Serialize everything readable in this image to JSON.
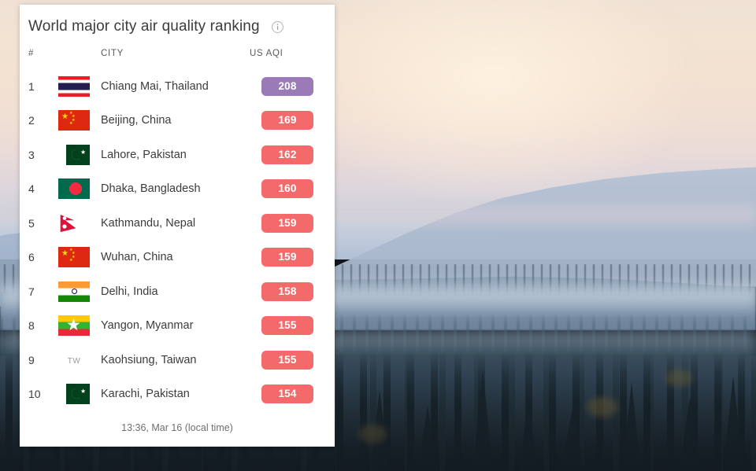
{
  "card": {
    "title": "World major city air quality ranking",
    "info_icon": "info-circle-icon",
    "columns": {
      "rank": "#",
      "city": "CITY",
      "aqi": "US AQI"
    },
    "footer": "13:36, Mar 16 (local time)",
    "rows": [
      {
        "rank": "1",
        "city": "Chiang Mai, Thailand",
        "aqi": "208",
        "flag": "flag-th",
        "flag_name": "flag-thailand",
        "badge_color": "#9b7ab8"
      },
      {
        "rank": "2",
        "city": "Beijing, China",
        "aqi": "169",
        "flag": "flag-cn",
        "flag_name": "flag-china",
        "badge_color": "#f46a6a"
      },
      {
        "rank": "3",
        "city": "Lahore, Pakistan",
        "aqi": "162",
        "flag": "flag-pk",
        "flag_name": "flag-pakistan",
        "badge_color": "#f46a6a"
      },
      {
        "rank": "4",
        "city": "Dhaka, Bangladesh",
        "aqi": "160",
        "flag": "flag-bd",
        "flag_name": "flag-bangladesh",
        "badge_color": "#f46a6a"
      },
      {
        "rank": "5",
        "city": "Kathmandu, Nepal",
        "aqi": "159",
        "flag": "flag-np",
        "flag_name": "flag-nepal",
        "badge_color": "#f46a6a"
      },
      {
        "rank": "6",
        "city": "Wuhan, China",
        "aqi": "159",
        "flag": "flag-cn",
        "flag_name": "flag-china",
        "badge_color": "#f46a6a"
      },
      {
        "rank": "7",
        "city": "Delhi, India",
        "aqi": "158",
        "flag": "flag-in",
        "flag_name": "flag-india",
        "badge_color": "#f46a6a"
      },
      {
        "rank": "8",
        "city": "Yangon, Myanmar",
        "aqi": "155",
        "flag": "flag-mm",
        "flag_name": "flag-myanmar",
        "badge_color": "#f46a6a"
      },
      {
        "rank": "9",
        "city": "Kaohsiung, Taiwan",
        "aqi": "155",
        "flag": "flag-tw",
        "flag_name": "flag-taiwan",
        "badge_color": "#f46a6a",
        "flag_text": "TW"
      },
      {
        "rank": "10",
        "city": "Karachi, Pakistan",
        "aqi": "154",
        "flag": "flag-pk",
        "flag_name": "flag-pakistan",
        "badge_color": "#f46a6a"
      }
    ]
  },
  "background": {
    "scene": "misty-forest-mountain-landscape-at-dusk",
    "sky_color": "#f2e3d3",
    "ridge_color": "#aebcd0",
    "forest_color": "#25343f"
  }
}
